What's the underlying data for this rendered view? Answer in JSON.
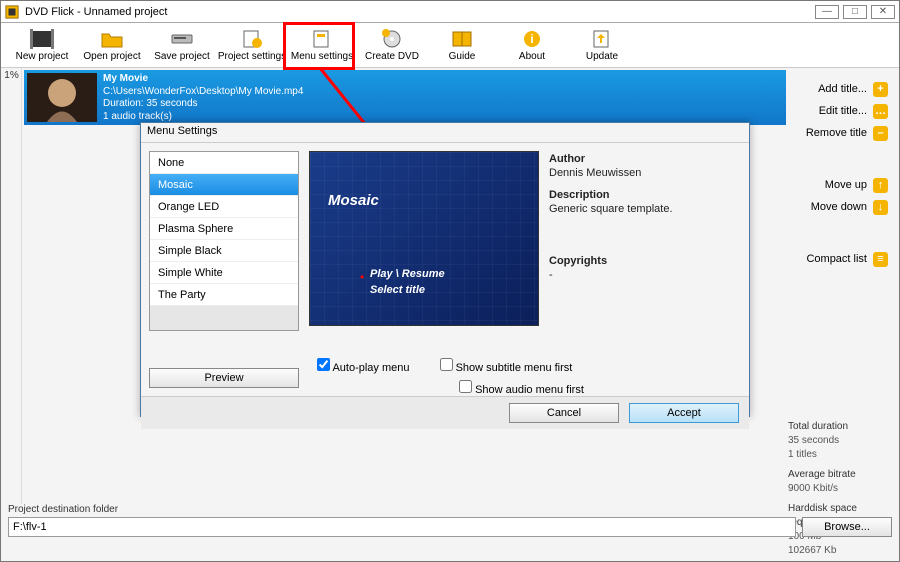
{
  "app_title": "DVD Flick - Unnamed project",
  "toolbar": [
    {
      "id": "new-project",
      "label": "New project",
      "icon": "film"
    },
    {
      "id": "open-project",
      "label": "Open project",
      "icon": "folder"
    },
    {
      "id": "save-project",
      "label": "Save project",
      "icon": "drive"
    },
    {
      "id": "project-settings",
      "label": "Project settings",
      "icon": "gear-sheet"
    },
    {
      "id": "menu-settings",
      "label": "Menu settings",
      "icon": "sheet"
    },
    {
      "id": "create-dvd",
      "label": "Create DVD",
      "icon": "disc-gear"
    },
    {
      "id": "guide",
      "label": "Guide",
      "icon": "book"
    },
    {
      "id": "about",
      "label": "About",
      "icon": "info"
    },
    {
      "id": "update",
      "label": "Update",
      "icon": "update"
    }
  ],
  "gauge_pct": "1%",
  "project_item": {
    "title": "My Movie",
    "path": "C:\\Users\\WonderFox\\Desktop\\My Movie.mp4",
    "duration": "Duration: 35 seconds",
    "audio": "1 audio track(s)"
  },
  "side_actions": [
    {
      "id": "add-title",
      "label": "Add title...",
      "icon": "+",
      "color": "#f5b400"
    },
    {
      "id": "edit-title",
      "label": "Edit title...",
      "icon": "…",
      "color": "#f5b400"
    },
    {
      "id": "remove-title",
      "label": "Remove title",
      "icon": "–",
      "color": "#f5b400"
    },
    {
      "id": "move-up",
      "label": "Move up",
      "icon": "↑",
      "color": "#f5b400"
    },
    {
      "id": "move-down",
      "label": "Move down",
      "icon": "↓",
      "color": "#f5b400"
    },
    {
      "id": "compact-list",
      "label": "Compact list",
      "icon": "≡",
      "color": "#f5b400"
    }
  ],
  "stats": {
    "total_duration_lbl": "Total duration",
    "total_duration_val": "35 seconds",
    "titles_val": "1 titles",
    "bitrate_lbl": "Average bitrate",
    "bitrate_val": "9000 Kbit/s",
    "space_lbl": "Harddisk space required",
    "space_val1": "100 Mb",
    "space_val2": "102667 Kb"
  },
  "dest": {
    "label": "Project destination folder",
    "value": "F:\\flv-1",
    "browse": "Browse..."
  },
  "dialog": {
    "title": "Menu Settings",
    "templates": [
      "None",
      "Mosaic",
      "Orange LED",
      "Plasma Sphere",
      "Simple Black",
      "Simple White",
      "The Party"
    ],
    "selected_index": 1,
    "preview_btn": "Preview",
    "preview": {
      "name": "Mosaic",
      "opt1": "Play \\ Resume",
      "opt2": "Select title"
    },
    "meta": {
      "author_lbl": "Author",
      "author_val": "Dennis Meuwissen",
      "desc_lbl": "Description",
      "desc_val": "Generic square template.",
      "copy_lbl": "Copyrights",
      "copy_val": "-"
    },
    "opts": {
      "autoplay": "Auto-play menu",
      "subtitle": "Show subtitle menu first",
      "audio": "Show audio menu first",
      "autoplay_checked": true,
      "subtitle_checked": false,
      "audio_checked": false
    },
    "cancel": "Cancel",
    "accept": "Accept"
  }
}
